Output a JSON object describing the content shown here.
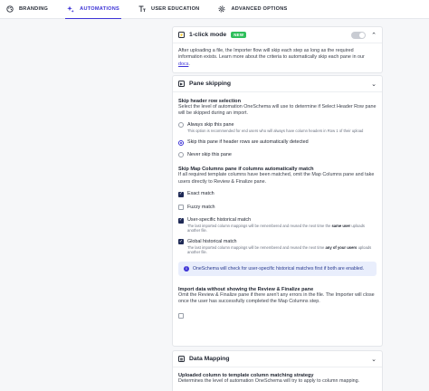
{
  "nav": {
    "tabs": [
      {
        "label": "BRANDING",
        "icon": "palette-icon",
        "active": false
      },
      {
        "label": "AUTOMATIONS",
        "icon": "sparkles-icon",
        "active": true
      },
      {
        "label": "USER EDUCATION",
        "icon": "text-icon",
        "active": false
      },
      {
        "label": "ADVANCED OPTIONS",
        "icon": "settings-icon",
        "active": false
      }
    ]
  },
  "one_click": {
    "title": "1-click mode",
    "badge": "NEW",
    "toggle_on": false,
    "desc": "After uploading a file, the Importer flow will skip each step as long as the required information exists. Learn more about the criteria to automatically skip each pane in our",
    "link": "docs",
    "desc_end": "."
  },
  "pane_skipping": {
    "title": "Pane skipping",
    "header_row": {
      "heading": "Skip header row selection",
      "desc": "Select the level of automation OneSchema will use to determine if Select Header Row pane will be skipped during an import.",
      "options": [
        {
          "label": "Always skip this pane",
          "sub": "This option is recommended for end users who will always have column headers in Row 1 of their upload",
          "selected": false
        },
        {
          "label": "Skip this pane if header rows are automatically detected",
          "sub": "",
          "selected": true
        },
        {
          "label": "Never skip this pane",
          "sub": "",
          "selected": false
        }
      ]
    },
    "map_columns": {
      "heading": "Skip Map Columns pane if columns automatically match",
      "desc": "If all required template columns have been matched, omit the Map Columns pane and take users directly to Review & Finalize pane.",
      "exact": {
        "label": "Exact match",
        "checked": true
      },
      "fuzzy": {
        "label": "Fuzzy match",
        "checked": false
      },
      "user_hist": {
        "label": "User-specific historical match",
        "checked": true,
        "sub_a": "The last imported column mappings will be remembered and reused the next time the",
        "sub_b": "same user",
        "sub_c": "uploads another file."
      },
      "global_hist": {
        "label": "Global historical match",
        "checked": true,
        "sub_a": "The last imported column mappings will be remembered and reused the next time",
        "sub_b": "any of your users",
        "sub_c": "uploads another file."
      },
      "info": "OneSchema will check for user-specific historical matches first if both are enabled."
    },
    "import_no_review": {
      "heading": "Import data without showing the Review & Finalize pane",
      "desc": "Omit the Review & Finalize pane if there aren't any errors in the file. The Importer will close once the user has successfully completed the Map Columns step.",
      "checked": false
    }
  },
  "data_mapping": {
    "title": "Data Mapping",
    "heading": "Uploaded column to template column matching strategy",
    "desc": "Determines the level of automation OneSchema will try to apply to column mapping."
  }
}
